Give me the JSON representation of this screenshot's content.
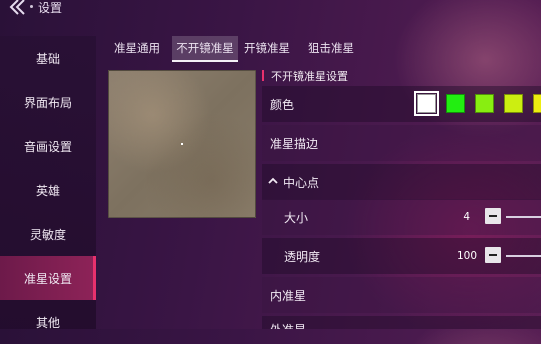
{
  "header": {
    "title": "设置"
  },
  "sidebar": {
    "items": [
      {
        "label": "基础"
      },
      {
        "label": "界面布局"
      },
      {
        "label": "音画设置"
      },
      {
        "label": "英雄"
      },
      {
        "label": "灵敏度"
      },
      {
        "label": "准星设置"
      },
      {
        "label": "其他"
      }
    ],
    "active_index": 5
  },
  "tabs": [
    {
      "label": "准星通用"
    },
    {
      "label": "不开镜准星"
    },
    {
      "label": "开镜准星"
    },
    {
      "label": "狙击准星"
    }
  ],
  "active_tab": 1,
  "section": {
    "title": "不开镜准星设置"
  },
  "settings": {
    "color": {
      "label": "颜色",
      "swatches": [
        "#ffffff",
        "#22ee11",
        "#88ee11",
        "#ccee11",
        "#eeee11"
      ]
    },
    "outline": {
      "label": "准星描边"
    },
    "center": {
      "label": "中心点"
    },
    "size": {
      "label": "大小",
      "value": "4"
    },
    "opacity": {
      "label": "透明度",
      "value": "100"
    },
    "inner": {
      "label": "内准星"
    },
    "outer": {
      "label": "外准星"
    }
  },
  "accent": "#e8316d"
}
